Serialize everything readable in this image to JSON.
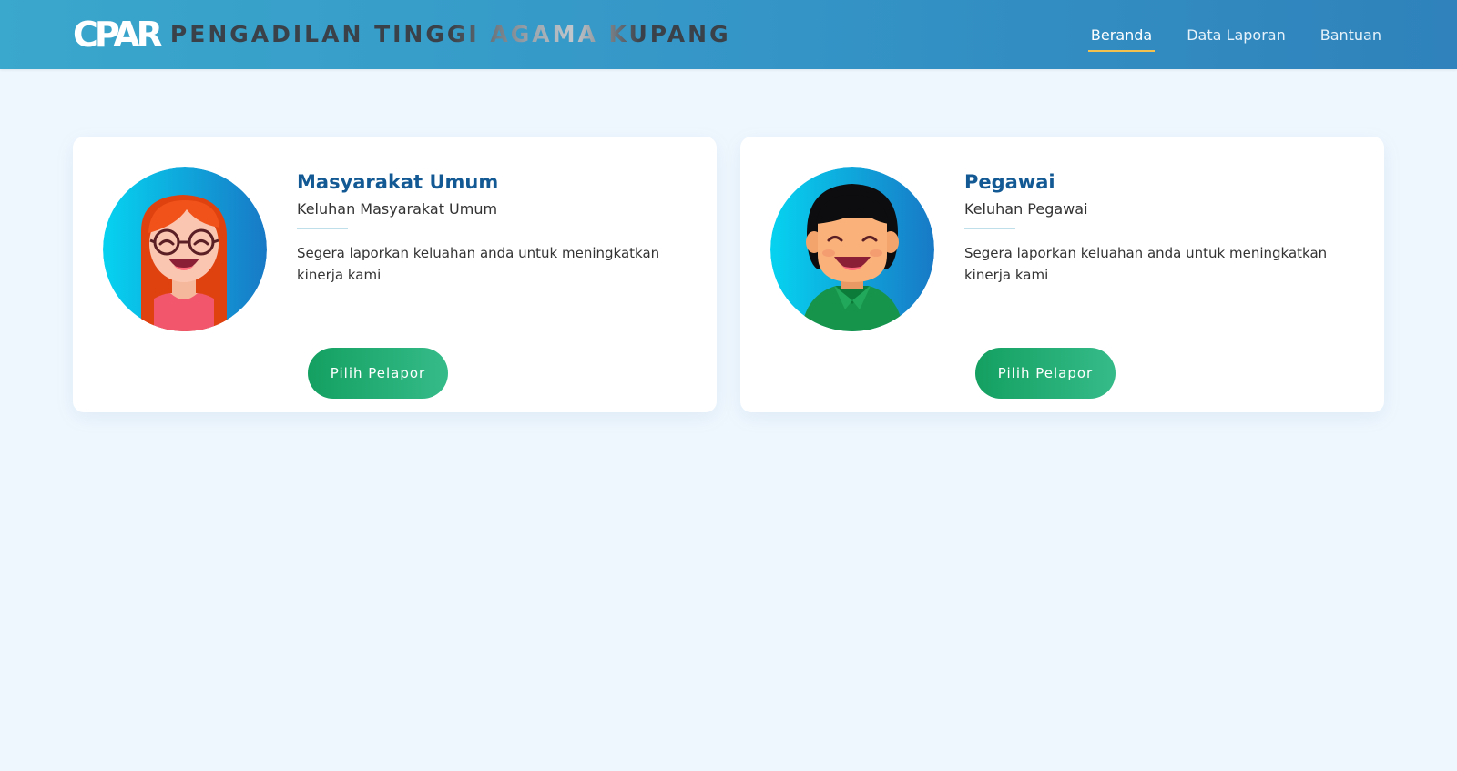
{
  "header": {
    "logo": "CPAR",
    "title": "PENGADILAN TINGGI AGAMA KUPANG",
    "nav": [
      {
        "label": "Beranda",
        "active": true
      },
      {
        "label": "Data Laporan",
        "active": false
      },
      {
        "label": "Bantuan",
        "active": false
      }
    ],
    "colors": {
      "gradient_start": "#3aa7cc",
      "gradient_end": "#2f82bb",
      "active_underline": "#f2c14e"
    }
  },
  "cards": [
    {
      "title": "Masyarakat Umum",
      "subtitle": "Keluhan Masyarakat Umum",
      "text": "Segera laporkan keluahan anda untuk meningkatkan kinerja kami",
      "button": "Pilih Pelapor",
      "avatar": "woman-avatar-icon"
    },
    {
      "title": "Pegawai",
      "subtitle": "Keluhan Pegawai",
      "text": "Segera laporkan keluahan anda untuk meningkatkan kinerja kami",
      "button": "Pilih Pelapor",
      "avatar": "man-avatar-icon"
    }
  ],
  "colors": {
    "page_bg": "#eff7fe",
    "title": "#135a94",
    "button_start": "#14a061",
    "button_end": "#35bb89"
  }
}
